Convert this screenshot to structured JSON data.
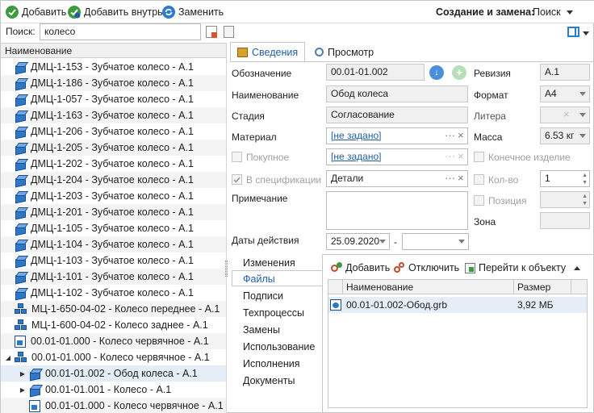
{
  "toolbar": {
    "add_label": "Добавить",
    "add_inside_label": "Добавить внутрь",
    "replace_label": "Заменить",
    "context_label": "Создание и замена:",
    "mode_value": "Поиск"
  },
  "search": {
    "label": "Поиск:",
    "value": "колесо"
  },
  "tree": {
    "header": "Наименование",
    "rows": [
      {
        "label": "ДМЦ-1-153  - Зубчатое колесо - А.1"
      },
      {
        "label": "ДМЦ-1-186  - Зубчатое колесо - А.1"
      },
      {
        "label": "ДМЦ-1-057  - Зубчатое колесо - А.1"
      },
      {
        "label": "ДМЦ-1-163  - Зубчатое колесо - А.1"
      },
      {
        "label": "ДМЦ-1-206 - Зубчатое колесо - А.1"
      },
      {
        "label": "ДМЦ-1-205 - Зубчатое колесо - А.1"
      },
      {
        "label": "ДМЦ-1-202 - Зубчатое колесо - А.1"
      },
      {
        "label": "ДМЦ-1-204 - Зубчатое колесо - А.1"
      },
      {
        "label": "ДМЦ-1-203 - Зубчатое колесо - А.1"
      },
      {
        "label": "ДМЦ-1-201 - Зубчатое колесо - А.1"
      },
      {
        "label": "ДМЦ-1-105 - Зубчатое колесо - А.1"
      },
      {
        "label": "ДМЦ-1-104 - Зубчатое колесо - А.1"
      },
      {
        "label": "ДМЦ-1-103 - Зубчатое колесо - А.1"
      },
      {
        "label": "ДМЦ-1-101 - Зубчатое колесо - А.1"
      },
      {
        "label": "ДМЦ-1-102 - Зубчатое колесо - А.1"
      },
      {
        "label": "МЦ-1-650-04-02 - Колесо переднее - А.1"
      },
      {
        "label": "МЦ-1-600-04-02 - Колесо заднее - А.1"
      },
      {
        "label": "00.01-01.000 - Колесо червячное - А.1"
      },
      {
        "label": "00.01-01.000 - Колесо червячное - А.1"
      },
      {
        "label": "00.01-01.002 - Обод колеса - А.1"
      },
      {
        "label": "00.01-01.001 - Колесо - А.1"
      },
      {
        "label": "00.01-01.000 - Колесо червячное - А.1"
      }
    ]
  },
  "tabs": {
    "info": "Сведения",
    "view": "Просмотр"
  },
  "form": {
    "designation_label": "Обозначение",
    "designation_value": "00.01-01.002",
    "revision_label": "Ревизия",
    "revision_value": "А.1",
    "name_label": "Наименование",
    "name_value": "Обод колеса",
    "format_label": "Формат",
    "format_value": "А4",
    "stage_label": "Стадия",
    "stage_value": "Согласование",
    "litera_label": "Литера",
    "material_label": "Материал",
    "material_value": "[не задано]",
    "mass_label": "Масса",
    "mass_value": "6.53 кг",
    "purchased_label": "Покупное",
    "purchased_value": "[не задано]",
    "final_product_label": "Конечное изделие",
    "in_spec_label": "В спецификации",
    "section_value": "Детали",
    "qty_label": "Кол-во",
    "qty_value": "1",
    "note_label": "Примечание",
    "position_label": "Позиция",
    "zone_label": "Зона",
    "dates_label": "Даты действия",
    "date_from": "25.09.2020",
    "date_sep": "-"
  },
  "sidetabs": [
    "Изменения",
    "Файлы",
    "Подписи",
    "Техпроцессы",
    "Замены",
    "Использование",
    "Исполнения",
    "Документы"
  ],
  "files": {
    "add_label": "Добавить",
    "detach_label": "Отключить",
    "goto_label": "Перейти к объекту",
    "col_name": "Наименование",
    "col_size": "Размер",
    "rows": [
      {
        "name": "00.01-01.002-Обод.grb",
        "size": "3,92 МБ"
      }
    ]
  }
}
